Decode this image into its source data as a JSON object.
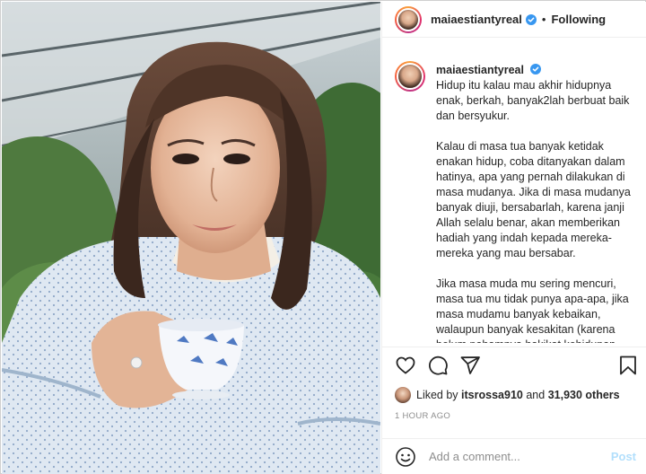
{
  "post": {
    "username": "maiaestiantyreal",
    "separator": "•",
    "follow_status": "Following"
  },
  "caption": {
    "username": "maiaestiantyreal",
    "paragraphs": [
      "Hidup itu kalau mau akhir hidupnya enak, berkah, banyak2lah berbuat baik dan bersyukur.",
      "Kalau di masa tua banyak ketidak enakan hidup, coba ditanyakan dalam hatinya, apa yang pernah dilakukan di masa mudanya. Jika di masa mudanya banyak diuji, bersabarlah, karena janji Allah selalu benar, akan memberikan hadiah yang indah kepada mereka-mereka yang mau bersabar.",
      "Jika masa muda mu sering mencuri, masa tua mu tidak punya apa-apa, jika masa mudamu banyak kebaikan, walaupun banyak kesakitan (karena belum pahamnya hakikat kehidupan,"
    ]
  },
  "likes": {
    "prefix": "Liked by",
    "user": "itsrossa910",
    "connector": "and",
    "others": "31,930 others"
  },
  "time_ago": "1 HOUR AGO",
  "comment": {
    "placeholder": "Add a comment...",
    "post_label": "Post"
  },
  "icons": {
    "like": "heart-icon",
    "comment": "comment-icon",
    "share": "share-icon",
    "save": "bookmark-icon",
    "emoji": "emoji-icon",
    "verified": "verified-badge-icon"
  },
  "colors": {
    "verified": "#3897f0",
    "post_disabled": "#b2dffc",
    "muted": "#8e8e8e"
  }
}
